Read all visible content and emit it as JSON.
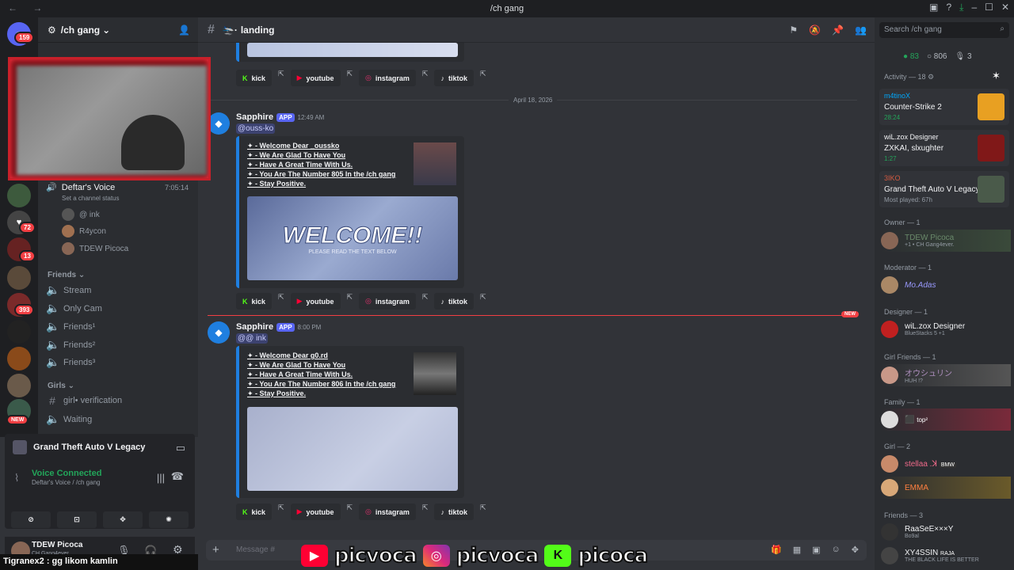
{
  "window": {
    "title": "/ch gang"
  },
  "server": {
    "name": "/ch gang"
  },
  "channels": {
    "voice_title": "Deftar's Voice",
    "voice_time": "7:05:14",
    "voice_status": "Set a channel status",
    "voice_users": [
      "@ ink",
      "R4ycon",
      "TDEW Picoca"
    ],
    "cat_friends": "Friends",
    "friends_channels": [
      "Stream",
      "Only Cam",
      "Friends¹",
      "Friends²",
      "Friends³"
    ],
    "cat_girls": "Girls",
    "girls_channels": [
      "girl• verification",
      "Waiting"
    ]
  },
  "guild_badges": {
    "top": "159",
    "b1": "72",
    "b2": "13",
    "b3": "393",
    "new": "NEW"
  },
  "voice_panel": {
    "game": "Grand Theft Auto V Legacy",
    "status": "Voice Connected",
    "location": "Deftar's Voice / /ch gang"
  },
  "user_panel": {
    "name": "TDEW Picoca",
    "sub": "CH Gang4ever."
  },
  "header": {
    "channel": "landing"
  },
  "messages": [
    {
      "author": "Sapphire",
      "app": "APP",
      "time": "12:49 AM",
      "mention": "@ouss-ko",
      "lines": [
        "✦ - Welcome Dear _oussko",
        "✦ - We Are Glad To Have You",
        "✦ - Have A Great Time With Us.",
        "✦ - You Are The Number 805 In the /ch gang",
        "✦ - Stay Positive."
      ],
      "banner_title": "WELCOME!!",
      "banner_sub": "PLEASE READ THE TEXT BELOW"
    },
    {
      "author": "Sapphire",
      "app": "APP",
      "time": "8:00 PM",
      "mention": "@@ ink",
      "lines": [
        "✦ - Welcome Dear g0.rd",
        "✦ - We Are Glad To Have You",
        "✦ - Have A Great Time With Us.",
        "✦ - You Are The Number 806 In the /ch gang",
        "✦ - Stay Positive."
      ]
    }
  ],
  "link_buttons": [
    "kick",
    "youtube",
    "instagram",
    "tiktok"
  ],
  "date_divider": "April 18, 2026",
  "new_label": "NEW",
  "composer": {
    "placeholder": "Message #"
  },
  "search": {
    "placeholder": "Search /ch gang"
  },
  "stats": {
    "online": "83",
    "total": "806",
    "voice": "3"
  },
  "activity": {
    "label": "Activity — 18",
    "items": [
      {
        "user": "m4tinoX",
        "game": "Counter-Strike 2",
        "time": "28:24"
      },
      {
        "user": "wiL.zox Designer",
        "game": "ZXKAI, slxughter",
        "time": "1:27"
      },
      {
        "user": "3IKO",
        "game": "Grand Theft Auto V Legacy",
        "time": "Most played: 67h"
      }
    ]
  },
  "members": [
    {
      "group": "Owner — 1",
      "name": "TDEW Picoca",
      "sub": "+1 • CH Gang4ever."
    },
    {
      "group": "Moderator — 1",
      "name": "Mo.Adas",
      "sub": ""
    },
    {
      "group": "Designer — 1",
      "name": "wiL.zox Designer",
      "sub": "BlueStacks 5 +1"
    },
    {
      "group": "Girl Friends — 1",
      "name": "オウシュリン",
      "sub": "HUH !?"
    },
    {
      "group": "Family — 1",
      "name": "",
      "sub": "top²"
    },
    {
      "group": "Girl — 2",
      "name": "stellaa .ꓘ",
      "sub": "BMW"
    },
    {
      "group": "",
      "name": "EMMA",
      "sub": ""
    },
    {
      "group": "Friends — 3",
      "name": "RaaSeE×××Y",
      "sub": "Bo9al"
    },
    {
      "group": "",
      "name": "XY4SSIN",
      "sub": "THE BLACK LIFE IS BETTER"
    }
  ],
  "member_extra": {
    "raja": "RAJA"
  },
  "overlay": {
    "text": "picvoca",
    "k": "picoca"
  },
  "ticker": "Tigranex2 : gg likom kamlin",
  "colors": {
    "accent": "#5865f2",
    "online": "#23a55a",
    "mention": "#3c4270"
  }
}
